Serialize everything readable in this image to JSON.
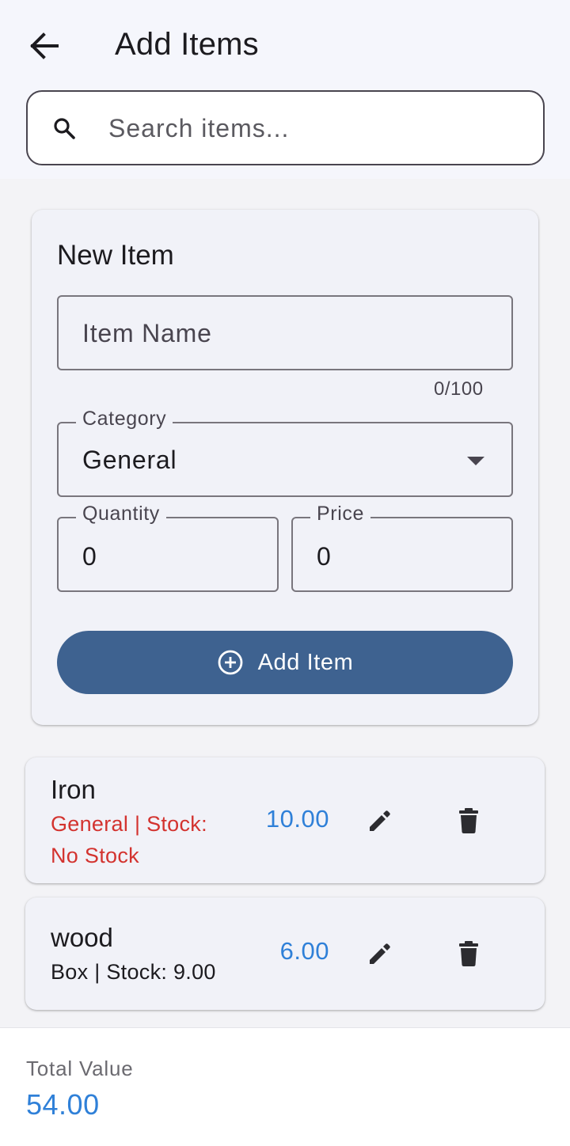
{
  "header": {
    "title": "Add Items",
    "back_icon": "arrow-left-icon"
  },
  "search": {
    "placeholder": "Search items...",
    "value": "",
    "icon": "search-icon"
  },
  "new_item": {
    "title": "New Item",
    "name_field": {
      "placeholder": "Item Name",
      "value": "",
      "counter": "0/100"
    },
    "category_field": {
      "label": "Category",
      "value": "General"
    },
    "quantity_field": {
      "label": "Quantity",
      "value": "0"
    },
    "price_field": {
      "label": "Price",
      "value": "0"
    },
    "add_button": {
      "label": "Add Item",
      "icon": "plus-circle-icon"
    }
  },
  "items": [
    {
      "name": "Iron",
      "subtitle": "General | Stock: No Stock",
      "price": "10.00",
      "stock_status": "no-stock"
    },
    {
      "name": "wood",
      "subtitle": "Box | Stock: 9.00",
      "price": "6.00",
      "stock_status": "in-stock"
    }
  ],
  "footer": {
    "total_label": "Total Value",
    "total_value": "54.00"
  },
  "colors": {
    "primary": "#3e6290",
    "price": "#2f80d8",
    "danger": "#d3332f"
  }
}
